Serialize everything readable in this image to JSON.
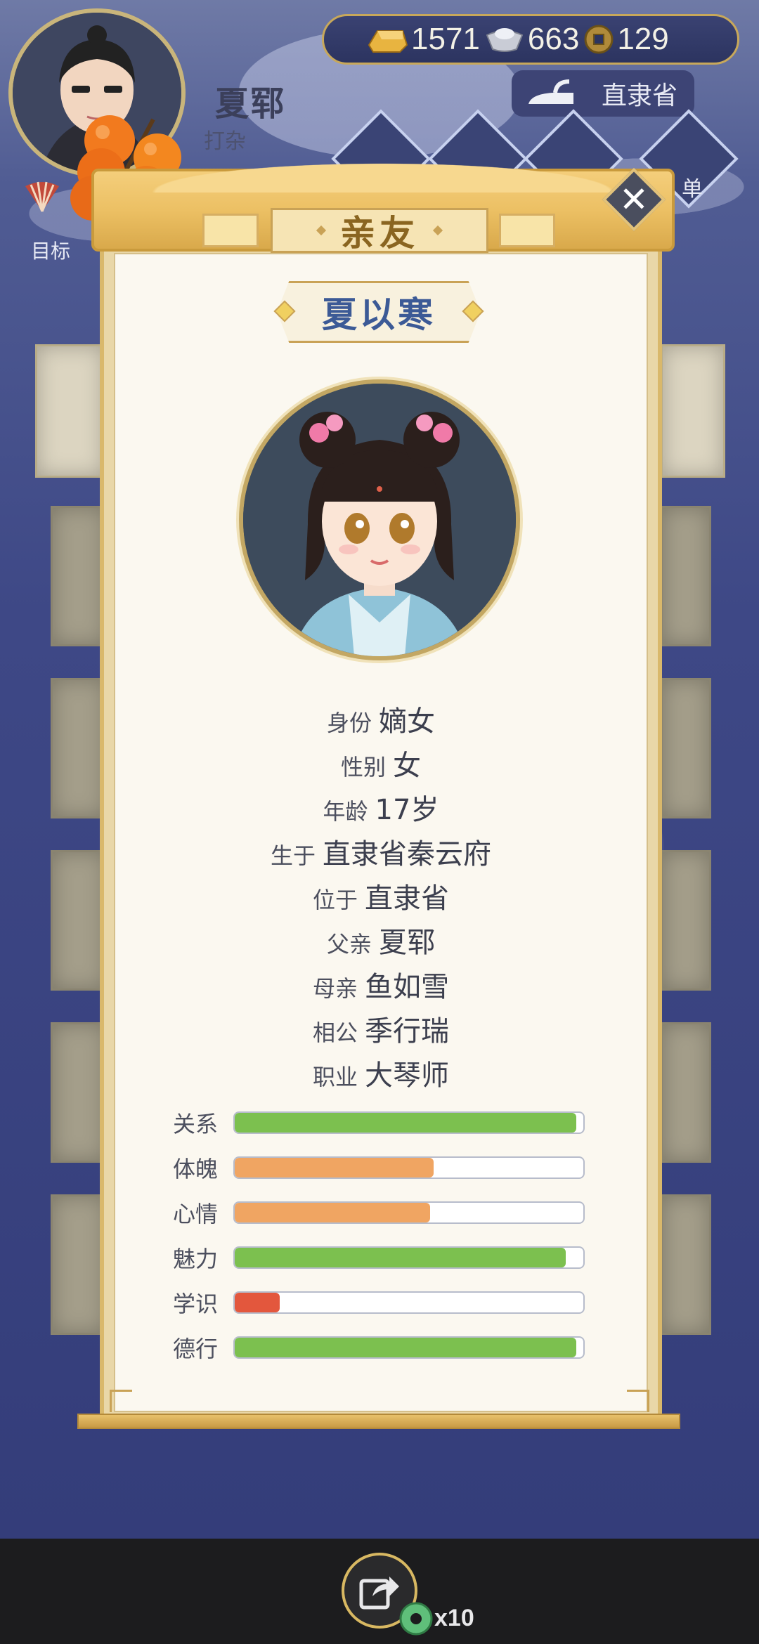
{
  "hud": {
    "player_name": "夏郓",
    "player_role": "打杂",
    "target_label": "目标",
    "currency": {
      "gold": "1571",
      "silver": "663",
      "coin": "129"
    },
    "location": "直隶省",
    "menu_partial_label": "单"
  },
  "panel": {
    "title": "亲友",
    "person_name": "夏以寒",
    "info": [
      {
        "label": "身份",
        "value": "嫡女"
      },
      {
        "label": "性别",
        "value": "女"
      },
      {
        "label": "年龄",
        "value": "17岁"
      },
      {
        "label": "生于",
        "value": "直隶省秦云府"
      },
      {
        "label": "位于",
        "value": "直隶省"
      },
      {
        "label": "父亲",
        "value": "夏郓"
      },
      {
        "label": "母亲",
        "value": "鱼如雪"
      },
      {
        "label": "相公",
        "value": "季行瑞"
      },
      {
        "label": "职业",
        "value": "大琴师"
      }
    ],
    "stats": [
      {
        "label": "关系",
        "fraction": 0.98,
        "color": "#7cc04f"
      },
      {
        "label": "体魄",
        "fraction": 0.57,
        "color": "#f0a562"
      },
      {
        "label": "心情",
        "fraction": 0.56,
        "color": "#f0a562"
      },
      {
        "label": "魅力",
        "fraction": 0.95,
        "color": "#7cc04f"
      },
      {
        "label": "学识",
        "fraction": 0.13,
        "color": "#e3573d"
      },
      {
        "label": "德行",
        "fraction": 0.98,
        "color": "#7cc04f"
      }
    ]
  },
  "bottom": {
    "multiplier": "x10"
  },
  "colors": {
    "accent_gold": "#c9a256",
    "name_blue": "#3c5a96",
    "bar_green": "#7cc04f",
    "bar_orange": "#f0a562",
    "bar_red": "#e3573d"
  }
}
